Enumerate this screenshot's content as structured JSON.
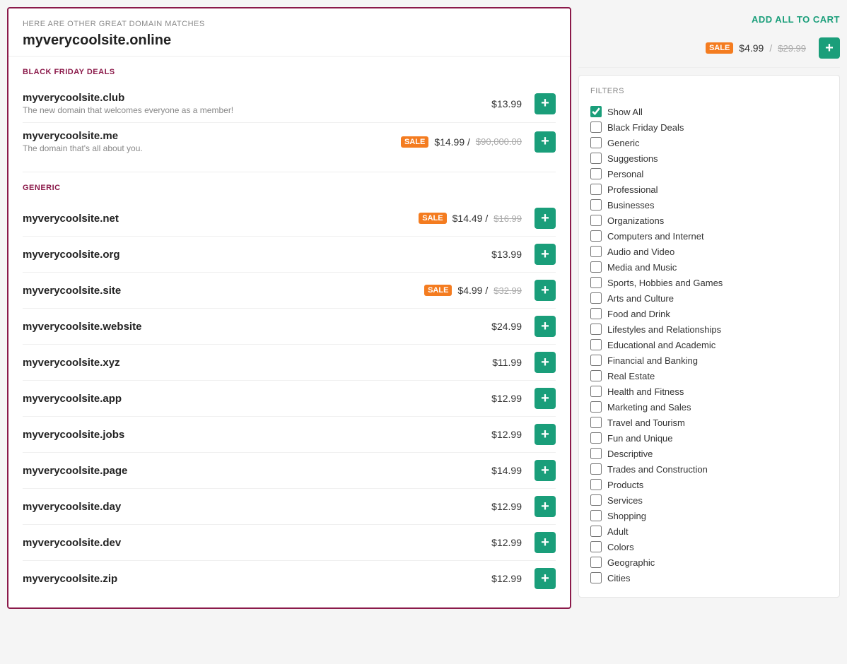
{
  "header": {
    "subtitle": "HERE ARE OTHER GREAT DOMAIN MATCHES",
    "domain_name": "myverycoolsite.online",
    "add_all_label": "ADD ALL TO CART"
  },
  "featured": {
    "sale_tag": "SALE",
    "price": "$4.99",
    "separator": "/",
    "orig_price": "$29.99"
  },
  "sections": [
    {
      "id": "black-friday",
      "label": "BLACK FRIDAY DEALS",
      "items": [
        {
          "domain": "myverycoolsite.club",
          "desc": "The new domain that welcomes everyone as a member!",
          "price": "$13.99",
          "sale": false,
          "sale_price": null,
          "orig_price": null
        },
        {
          "domain": "myverycoolsite.me",
          "desc": "The domain that's all about you.",
          "price": "$14.99",
          "sale": true,
          "sale_price": "$14.99",
          "orig_price": "$90,000.00"
        }
      ]
    },
    {
      "id": "generic",
      "label": "GENERIC",
      "items": [
        {
          "domain": "myverycoolsite.net",
          "desc": null,
          "price": "$14.49",
          "sale": true,
          "sale_price": "$14.49",
          "orig_price": "$16.99"
        },
        {
          "domain": "myverycoolsite.org",
          "desc": null,
          "price": "$13.99",
          "sale": false,
          "sale_price": null,
          "orig_price": null
        },
        {
          "domain": "myverycoolsite.site",
          "desc": null,
          "price": "$4.99",
          "sale": true,
          "sale_price": "$4.99",
          "orig_price": "$32.99"
        },
        {
          "domain": "myverycoolsite.website",
          "desc": null,
          "price": "$24.99",
          "sale": false,
          "sale_price": null,
          "orig_price": null
        },
        {
          "domain": "myverycoolsite.xyz",
          "desc": null,
          "price": "$11.99",
          "sale": false,
          "sale_price": null,
          "orig_price": null
        },
        {
          "domain": "myverycoolsite.app",
          "desc": null,
          "price": "$12.99",
          "sale": false,
          "sale_price": null,
          "orig_price": null
        },
        {
          "domain": "myverycoolsite.jobs",
          "desc": null,
          "price": "$12.99",
          "sale": false,
          "sale_price": null,
          "orig_price": null
        },
        {
          "domain": "myverycoolsite.page",
          "desc": null,
          "price": "$14.99",
          "sale": false,
          "sale_price": null,
          "orig_price": null
        },
        {
          "domain": "myverycoolsite.day",
          "desc": null,
          "price": "$12.99",
          "sale": false,
          "sale_price": null,
          "orig_price": null
        },
        {
          "domain": "myverycoolsite.dev",
          "desc": null,
          "price": "$12.99",
          "sale": false,
          "sale_price": null,
          "orig_price": null
        },
        {
          "domain": "myverycoolsite.zip",
          "desc": null,
          "price": "$12.99",
          "sale": false,
          "sale_price": null,
          "orig_price": null
        }
      ]
    }
  ],
  "filters": {
    "title": "FILTERS",
    "items": [
      {
        "label": "Show All",
        "checked": true
      },
      {
        "label": "Black Friday Deals",
        "checked": false
      },
      {
        "label": "Generic",
        "checked": false
      },
      {
        "label": "Suggestions",
        "checked": false
      },
      {
        "label": "Personal",
        "checked": false
      },
      {
        "label": "Professional",
        "checked": false
      },
      {
        "label": "Businesses",
        "checked": false
      },
      {
        "label": "Organizations",
        "checked": false
      },
      {
        "label": "Computers and Internet",
        "checked": false
      },
      {
        "label": "Audio and Video",
        "checked": false
      },
      {
        "label": "Media and Music",
        "checked": false
      },
      {
        "label": "Sports, Hobbies and Games",
        "checked": false
      },
      {
        "label": "Arts and Culture",
        "checked": false
      },
      {
        "label": "Food and Drink",
        "checked": false
      },
      {
        "label": "Lifestyles and Relationships",
        "checked": false
      },
      {
        "label": "Educational and Academic",
        "checked": false
      },
      {
        "label": "Financial and Banking",
        "checked": false
      },
      {
        "label": "Real Estate",
        "checked": false
      },
      {
        "label": "Health and Fitness",
        "checked": false
      },
      {
        "label": "Marketing and Sales",
        "checked": false
      },
      {
        "label": "Travel and Tourism",
        "checked": false
      },
      {
        "label": "Fun and Unique",
        "checked": false
      },
      {
        "label": "Descriptive",
        "checked": false
      },
      {
        "label": "Trades and Construction",
        "checked": false
      },
      {
        "label": "Products",
        "checked": false
      },
      {
        "label": "Services",
        "checked": false
      },
      {
        "label": "Shopping",
        "checked": false
      },
      {
        "label": "Adult",
        "checked": false
      },
      {
        "label": "Colors",
        "checked": false
      },
      {
        "label": "Geographic",
        "checked": false
      },
      {
        "label": "Cities",
        "checked": false
      }
    ]
  },
  "colors": {
    "sale_bg": "#f47c20",
    "add_btn": "#1a9e7a",
    "section_label": "#8b1a4a",
    "add_all": "#1a9e7a"
  },
  "add_btn_label": "+"
}
